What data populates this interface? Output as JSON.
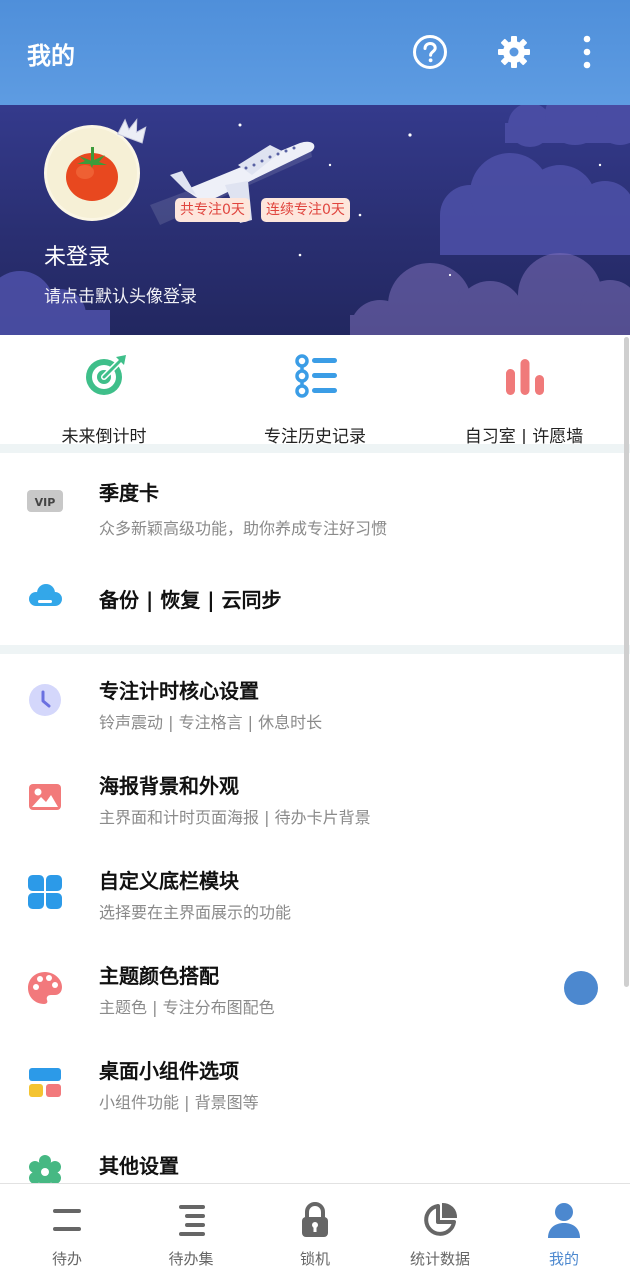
{
  "appbar": {
    "title": "我的",
    "icons": [
      "help-icon",
      "gear-icon",
      "more-vertical-icon"
    ]
  },
  "profile": {
    "total_focus_badge": "共专注0天",
    "streak_badge": "连续专注0天",
    "name": "未登录",
    "hint": "请点击默认头像登录"
  },
  "quick_actions": [
    {
      "label": "未来倒计时",
      "icon": "target-icon",
      "color": "#3fbf8a"
    },
    {
      "label": "专注历史记录",
      "icon": "history-list-icon",
      "color": "#3b9de6"
    },
    {
      "label": "自习室 | 许愿墙",
      "icon": "bar-chart-icon",
      "color": "#f07a7a"
    }
  ],
  "list": [
    {
      "title": "季度卡",
      "subtitle": "众多新颖高级功能，助你养成专注好习惯",
      "icon": "vip-icon"
    },
    {
      "title": "备份 | 恢复 | 云同步",
      "subtitle": "",
      "icon": "cloud-icon"
    },
    {
      "title": "专注计时核心设置",
      "subtitle": "铃声震动 | 专注格言 | 休息时长",
      "icon": "clock-icon"
    },
    {
      "title": "海报背景和外观",
      "subtitle": "主界面和计时页面海报 | 待办卡片背景",
      "icon": "image-icon"
    },
    {
      "title": "自定义底栏模块",
      "subtitle": "选择要在主界面展示的功能",
      "icon": "clover-icon"
    },
    {
      "title": "主题颜色搭配",
      "subtitle": "主题色 | 专注分布图配色",
      "icon": "palette-icon"
    },
    {
      "title": "桌面小组件选项",
      "subtitle": "小组件功能 | 背景图等",
      "icon": "widget-icon"
    },
    {
      "title": "其他设置",
      "subtitle": "",
      "icon": "settings-flower-icon"
    }
  ],
  "bottom_nav": [
    {
      "label": "待办",
      "icon": "todo-icon",
      "active": false
    },
    {
      "label": "待办集",
      "icon": "todo-set-icon",
      "active": false
    },
    {
      "label": "锁机",
      "icon": "lock-icon",
      "active": false
    },
    {
      "label": "统计数据",
      "icon": "pie-chart-icon",
      "active": false
    },
    {
      "label": "我的",
      "icon": "user-icon",
      "active": true
    }
  ],
  "colors": {
    "appbar": "#5596de",
    "accent": "#4c88cf",
    "banner": "#2c3178",
    "badge_text": "#e0453e",
    "badge_bg": "#fde6dc"
  }
}
